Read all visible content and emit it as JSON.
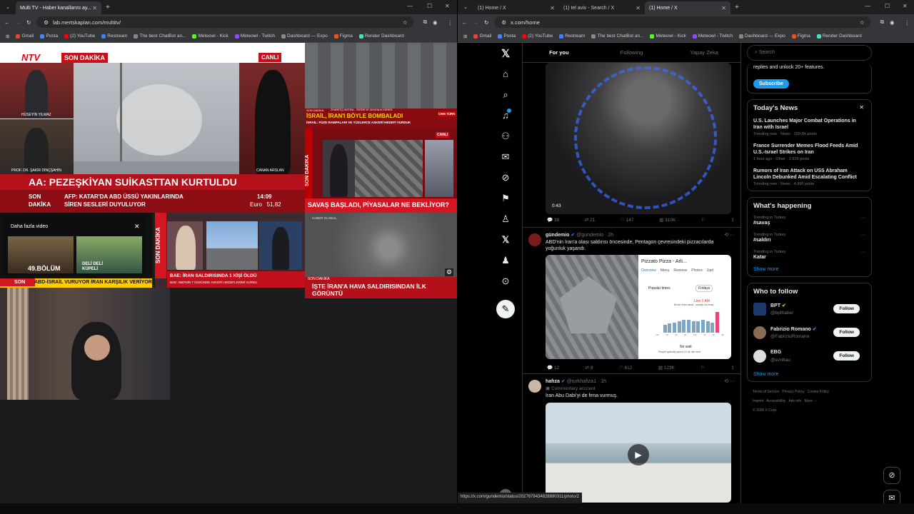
{
  "left_window": {
    "tab_title": "Multi TV - Haber kanallarını ay...",
    "url": "lab.mertskaplan.com/multitv/",
    "bookmarks": [
      "Gmail",
      "Posta",
      "(2) YouTube",
      "Restream",
      "The best ChatBot an...",
      "Meteowl - Kick",
      "Meteowl - Twitch",
      "Dashboard — Expo",
      "Figma",
      "Render Dashboard"
    ],
    "tv1": {
      "logo": "NTV",
      "section": "SON DAKİKA",
      "live": "CANLI",
      "guest1": "HÜSEYİN YILMAZ",
      "guest2": "PROF. DR. ŞAKİR DİNÇŞAHİN",
      "anchor": "CANAN ARSLAN",
      "headline": "AA: PEZEŞKİYAN SUİKASTTAN KURTULDU",
      "ticker_label_1": "SON",
      "ticker_label_2": "DAKİKA",
      "ticker_line1": "AFP: KATAR'DA ABD ÜSSÜ YAKINLARINDA",
      "ticker_line2": "SİREN SESLERİ DUYULUYOR",
      "time": "14:09",
      "currency": "Euro   51,82"
    },
    "tv2": {
      "section": "SON DAKİKA",
      "sub": "ZİYARETÇİ SİSTEM... TERÖR VE GÜVENLİK KÜRESİ",
      "headline": "İSRAİL, İRAN'I BÖYLE BOMBALADI",
      "subline": "İSRAİL: FÜZE RAMPALARI VE YÜZLERCE ASKERİ HEDEFİ VURDUK",
      "channel": "CNN TÜRK"
    },
    "tv3": {
      "vertical": "SON DAKİKA",
      "live": "CANLI",
      "headline": "SAVAŞ BAŞLADI, PİYASALAR NE BEKLİYOR?"
    },
    "tv4": {
      "popup_title": "Daha fazla video",
      "episode": "49.BÖLÜM",
      "show": "DELİ DELİ KÜPELİ",
      "ticker_label": "SON",
      "ticker": "ABD-İSRAİL VURUYOR İRAN KARŞILIK VERİYOR"
    },
    "tv5": {
      "vertical": "SON DAKİKA",
      "headline": "BAE: İRAN SALDIRISINDA 1 KİŞİ ÖLDÜ",
      "subline": "BAE: ABD'NİN 7 ÜSSÜNDE ASKERİ HEDEFLERİMİ VURDU"
    },
    "tv6": {
      "tag": "HABER GLOBAL",
      "section": "SON DAKİKA",
      "headline": "İŞTE İRAN'A HAVA SALDIRISINDAN İLK GÖRÜNTÜ"
    }
  },
  "right_window": {
    "tabs": [
      "(1) Home / X",
      "(1) tel aviv - Search / X",
      "(1) Home / X"
    ],
    "url": "x.com/home",
    "bookmarks": [
      "Gmail",
      "Posta",
      "(2) YouTube",
      "Restream",
      "The best ChatBot an...",
      "Meteowl - Kick",
      "Meteowl - Twitch",
      "Dashboard — Expo",
      "Figma",
      "Render Dashboard"
    ],
    "status_url": "https://x.com/gundemio/status/2027679434828890311/photo/2",
    "feed_tabs": [
      "For you",
      "Following",
      "Yapay Zeka"
    ],
    "post1": {
      "video_time": "0:43",
      "replies": "38",
      "reposts": "21",
      "likes": "147",
      "views": "310K"
    },
    "post2": {
      "name": "gündemio",
      "handle": "@gundemio · 2h",
      "text": "ABD'nin İran'a olası saldırısı öncesinde, Pentagon çevresindeki pizzacılarda yoğunluk yaşandı.",
      "card_title": "Pizzato Pizza - Arli...",
      "card_tabs": [
        "Overview",
        "Menu",
        "Reviews",
        "Photos",
        "Upd"
      ],
      "popular_times": "Popular times",
      "day": "Fridays",
      "live_label": "Live 1 AM",
      "live_sub": "Busier than usual · usually not busy",
      "no_wait": "No wait",
      "spend": "People typically spend 10-45 min here",
      "hours": [
        "12a",
        "3a",
        "6a",
        "9a",
        "12p",
        "3p",
        "6p",
        "9p"
      ],
      "bars": [
        0.35,
        0.4,
        0.45,
        0.5,
        0.55,
        0.55,
        0.5,
        0.5,
        0.55,
        0.5,
        0.45,
        0.9
      ],
      "replies": "12",
      "reposts": "8",
      "likes": "612",
      "views": "123K"
    },
    "post3": {
      "name": "hafıza",
      "handle": "@turkhafiza1 · 1h",
      "account": "Commentary account",
      "text": "İran Abu Dabi'yi de fena vurmuş."
    },
    "search_placeholder": "Search",
    "premium_text": "replies and unlock 20+ features.",
    "subscribe": "Subscribe",
    "news": {
      "title": "Today's News",
      "items": [
        {
          "t": "U.S. Launches Major Combat Operations in Iran with Israel",
          "m": "Trending now · News · 100.8K posts"
        },
        {
          "t": "France Surrender Memes Flood Feeds Amid U.S.-Israel Strikes on Iran",
          "m": "1 hour ago · Other · 2,929 posts"
        },
        {
          "t": "Rumors of Iran Attack on USS Abraham Lincoln Debunked Amid Escalating Conflict",
          "m": "Trending now · News · 4,995 posts"
        }
      ]
    },
    "happening": {
      "title": "What's happening",
      "items": [
        {
          "ctx": "Trending in Turkey",
          "tag": "#savaş"
        },
        {
          "ctx": "Trending in Turkey",
          "tag": "#saldırı"
        },
        {
          "ctx": "Trending in Turkey",
          "tag": "Katar"
        }
      ],
      "show_more": "Show more"
    },
    "who": {
      "title": "Who to follow",
      "items": [
        {
          "name": "BPT",
          "handle": "@bpthaber"
        },
        {
          "name": "Fabrizio Romano",
          "handle": "@FabrizioRomano"
        },
        {
          "name": "EBG",
          "handle": "@ezrittau"
        }
      ],
      "follow": "Follow",
      "show_more": "Show more"
    },
    "footer": [
      "Terms of Service",
      "Privacy Policy",
      "Cookie Policy",
      "Imprint",
      "Accessibility",
      "Ads info",
      "More ···",
      "© 2026 X Corp."
    ]
  }
}
